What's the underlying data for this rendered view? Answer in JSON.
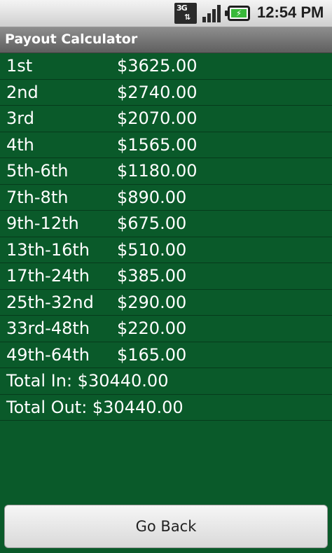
{
  "status_bar": {
    "time": "12:54 PM",
    "network": "3G",
    "icons": [
      "3g-data-icon",
      "signal-strength-icon",
      "battery-charging-icon"
    ]
  },
  "title_bar": {
    "title": "Payout Calculator"
  },
  "payouts": [
    {
      "place": "1st",
      "amount": "$3625.00"
    },
    {
      "place": "2nd",
      "amount": "$2740.00"
    },
    {
      "place": "3rd",
      "amount": "$2070.00"
    },
    {
      "place": "4th",
      "amount": "$1565.00"
    },
    {
      "place": "5th-6th",
      "amount": "$1180.00"
    },
    {
      "place": "7th-8th",
      "amount": "$890.00"
    },
    {
      "place": "9th-12th",
      "amount": "$675.00"
    },
    {
      "place": "13th-16th",
      "amount": "$510.00"
    },
    {
      "place": "17th-24th",
      "amount": "$385.00"
    },
    {
      "place": "25th-32nd",
      "amount": "$290.00"
    },
    {
      "place": "33rd-48th",
      "amount": "$220.00"
    },
    {
      "place": "49th-64th",
      "amount": "$165.00"
    }
  ],
  "totals": {
    "total_in": "Total In: $30440.00",
    "total_out": "Total Out: $30440.00"
  },
  "actions": {
    "go_back_label": "Go Back"
  },
  "colors": {
    "background": "#0a5a2a",
    "text": "#ffffff",
    "title_bar": "#6f6f6f"
  }
}
